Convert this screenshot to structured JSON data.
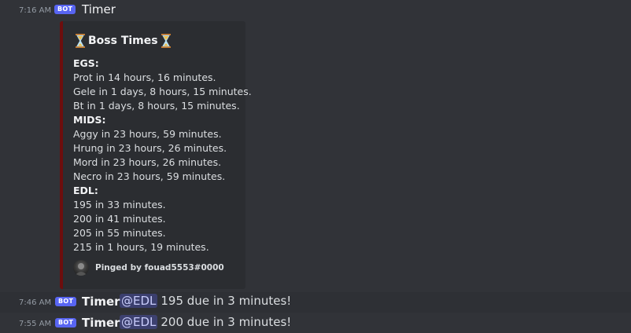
{
  "messages": [
    {
      "timestamp": "7:16 AM",
      "bot_tag": "BOT",
      "author": "Timer",
      "embed": {
        "title": "Boss Times",
        "title_icon": "hourglass-icon",
        "accent_color": "#6d0d0d",
        "lines": [
          {
            "text": "EGS:",
            "header": true
          },
          {
            "text": "Prot in 14 hours, 16 minutes."
          },
          {
            "text": "Gele in 1 days, 8 hours, 15 minutes."
          },
          {
            "text": "Bt in 1 days, 8 hours, 15 minutes."
          },
          {
            "text": "MIDS:",
            "header": true
          },
          {
            "text": "Aggy in 23 hours, 59 minutes."
          },
          {
            "text": "Hrung in 23 hours, 26 minutes."
          },
          {
            "text": "Mord in 23 hours, 26 minutes."
          },
          {
            "text": "Necro in 23 hours, 59 minutes."
          },
          {
            "text": "EDL:",
            "header": true
          },
          {
            "text": "195 in 33 minutes."
          },
          {
            "text": "200 in 41 minutes."
          },
          {
            "text": "205 in 55 minutes."
          },
          {
            "text": "215 in 1 hours, 19 minutes."
          }
        ],
        "footer": "Pinged by fouad5553#0000"
      }
    },
    {
      "timestamp": "7:46 AM",
      "bot_tag": "BOT",
      "author": "Timer",
      "mention": "@EDL",
      "text": "195 due in 3 minutes!"
    },
    {
      "timestamp": "7:55 AM",
      "bot_tag": "BOT",
      "author": "Timer",
      "mention": "@EDL",
      "text": "200 due in 3 minutes!"
    }
  ]
}
